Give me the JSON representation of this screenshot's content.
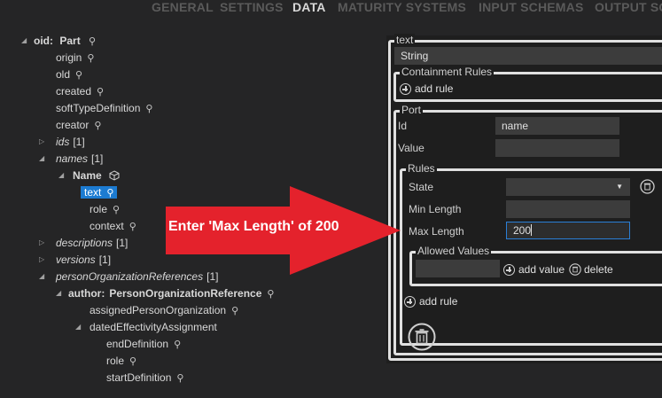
{
  "tabs": [
    "GENERAL",
    "SETTINGS",
    "DATA",
    "MATURITY SYSTEMS",
    "INPUT SCHEMAS",
    "OUTPUT SC"
  ],
  "active_tab": "DATA",
  "tree": {
    "root": {
      "key": "oid:",
      "type": "Part"
    },
    "items": [
      {
        "label": "origin"
      },
      {
        "label": "old"
      },
      {
        "label": "created"
      },
      {
        "label": "softTypeDefinition"
      },
      {
        "label": "creator"
      },
      {
        "label": "ids",
        "count": "[1]"
      },
      {
        "label": "names",
        "count": "[1]"
      },
      {
        "label": "Name"
      },
      {
        "label": "text"
      },
      {
        "label": "role"
      },
      {
        "label": "context"
      },
      {
        "label": "descriptions",
        "count": "[1]"
      },
      {
        "label": "versions",
        "count": "[1]"
      },
      {
        "label": "personOrganizationReferences",
        "count": "[1]"
      },
      {
        "label": "author:",
        "type": "PersonOrganizationReference"
      },
      {
        "label": "assignedPersonOrganization"
      },
      {
        "label": "datedEffectivityAssignment"
      },
      {
        "label": "endDefinition"
      },
      {
        "label": "role"
      },
      {
        "label": "startDefinition"
      }
    ]
  },
  "panel": {
    "text_legend": "text",
    "type_value": "String",
    "containment_legend": "Containment Rules",
    "add_rule_label": "add rule",
    "port_legend": "Port",
    "id_label": "Id",
    "id_value": "name",
    "value_label": "Value",
    "value_value": "",
    "rules_legend": "Rules",
    "state_label": "State",
    "min_length_label": "Min Length",
    "min_length_value": "",
    "max_length_label": "Max Length",
    "max_length_value": "200",
    "allowed_values_legend": "Allowed Values",
    "add_value_label": "add value",
    "delete_label": "delete",
    "add_rule_bottom_label": "add rule"
  },
  "callout": {
    "text": "Enter 'Max Length' of 200",
    "color": "#e4222c"
  },
  "colors": {
    "background": "#252526",
    "panel_background": "#1e1e1e",
    "selection": "#1c7bd1",
    "focus_border": "#2a7fd6"
  }
}
